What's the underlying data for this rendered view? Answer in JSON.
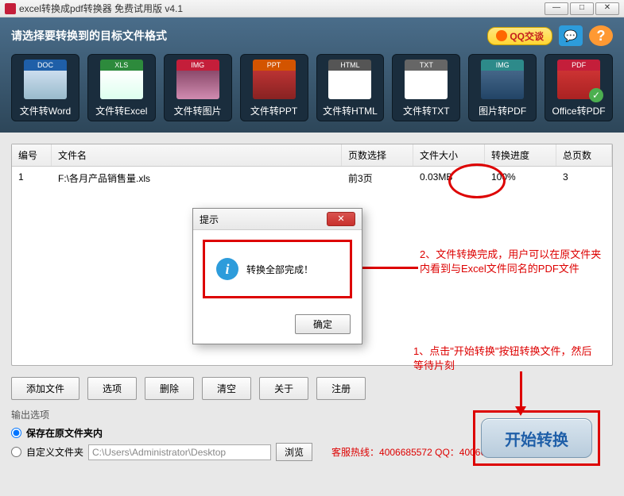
{
  "window": {
    "title": "excel转换成pdf转换器 免费试用版 v4.1"
  },
  "header": {
    "prompt": "请选择要转换到的目标文件格式",
    "qq_label": "QQ交谈",
    "help_label": "?"
  },
  "formats": [
    {
      "badge": "DOC",
      "label": "文件转Word",
      "cls": "doc"
    },
    {
      "badge": "XLS",
      "label": "文件转Excel",
      "cls": "xls"
    },
    {
      "badge": "IMG",
      "label": "文件转图片",
      "cls": "img"
    },
    {
      "badge": "PPT",
      "label": "文件转PPT",
      "cls": "ppt"
    },
    {
      "badge": "HTML",
      "label": "文件转HTML",
      "cls": "htm"
    },
    {
      "badge": "TXT",
      "label": "文件转TXT",
      "cls": "txt"
    },
    {
      "badge": "IMG",
      "label": "图片转PDF",
      "cls": "imgp"
    },
    {
      "badge": "PDF",
      "label": "Office转PDF",
      "cls": "pdf"
    }
  ],
  "table": {
    "headers": {
      "num": "编号",
      "name": "文件名",
      "pages": "页数选择",
      "size": "文件大小",
      "prog": "转换进度",
      "total": "总页数"
    },
    "row": {
      "num": "1",
      "name": "F:\\各月产品销售量.xls",
      "pages": "前3页",
      "size": "0.03MB",
      "prog": "100%",
      "total": "3"
    }
  },
  "dialog": {
    "title": "提示",
    "message": "转换全部完成！",
    "ok": "确定"
  },
  "annotations": {
    "a1": "1、点击\"开始转换\"按钮转换文件，然后等待片刻",
    "a2": "2、文件转换完成，用户可以在原文件夹内看到与Excel文件同名的PDF文件"
  },
  "buttons": {
    "add": "添加文件",
    "options": "选项",
    "delete": "删除",
    "clear": "清空",
    "about": "关于",
    "register": "注册",
    "start": "开始转换",
    "browse": "浏览"
  },
  "output": {
    "title": "输出选项",
    "opt1": "保存在原文件夹内",
    "opt2": "自定义文件夹",
    "path": "C:\\Users\\Administrator\\Desktop",
    "hotline": "客服热线：4006685572 QQ：4006685572"
  }
}
